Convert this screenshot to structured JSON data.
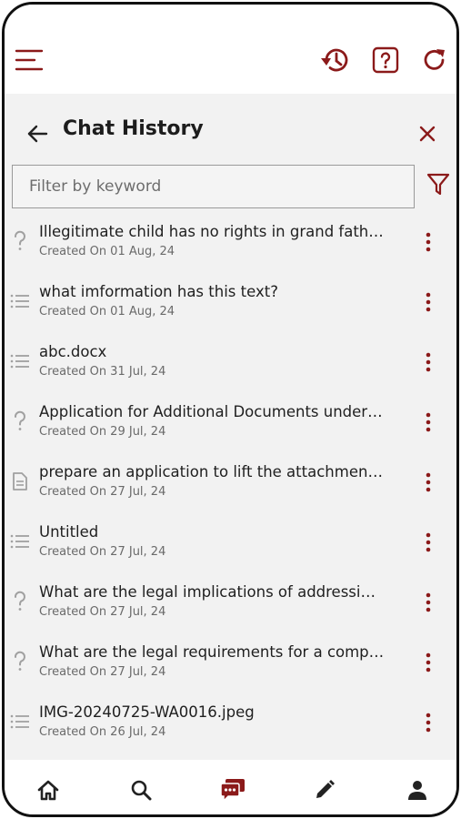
{
  "colors": {
    "accent": "#8b1a1a",
    "icon_dark": "#222222",
    "icon_gray": "#a0a0a0"
  },
  "topbar": {
    "icons": [
      "menu-icon",
      "history-icon",
      "help-icon",
      "refresh-icon"
    ]
  },
  "panel": {
    "title": "Chat History",
    "filter_placeholder": "Filter by keyword"
  },
  "history": [
    {
      "icon": "question-icon",
      "title": "Illegitimate child has no rights in grand fathe...",
      "date": "Created On 01 Aug, 24"
    },
    {
      "icon": "list-icon",
      "title": "what imformation has this text?",
      "date": "Created On 01 Aug, 24"
    },
    {
      "icon": "list-icon",
      "title": "abc.docx",
      "date": "Created On 31 Jul, 24"
    },
    {
      "icon": "question-icon",
      "title": "Application for Additional Documents under ...",
      "date": "Created On 29 Jul, 24"
    },
    {
      "icon": "document-icon",
      "title": "prepare an application to lift the attachmenti...",
      "date": "Created On 27 Jul, 24"
    },
    {
      "icon": "list-icon",
      "title": "Untitled",
      "date": "Created On 27 Jul, 24"
    },
    {
      "icon": "question-icon",
      "title": "What are the legal implications of addressing...",
      "date": "Created On 27 Jul, 24"
    },
    {
      "icon": "question-icon",
      "title": "What are the legal requirements for a compa...",
      "date": "Created On 27 Jul, 24"
    },
    {
      "icon": "list-icon",
      "title": "IMG-20240725-WA0016.jpeg",
      "date": "Created On 26 Jul, 24"
    }
  ],
  "bottom_nav": [
    "home-icon",
    "search-icon",
    "chat-icon",
    "edit-icon",
    "profile-icon"
  ]
}
